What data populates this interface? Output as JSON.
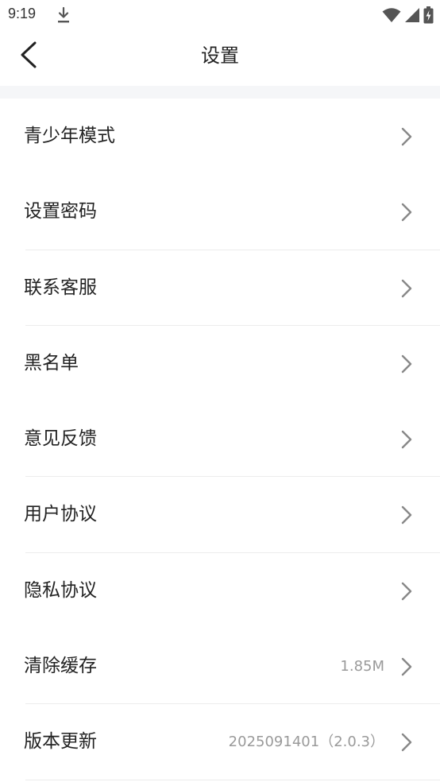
{
  "status_bar": {
    "time": "9:19"
  },
  "header": {
    "title": "设置"
  },
  "settings": {
    "items": [
      {
        "label": "青少年模式",
        "value": "",
        "divider": false
      },
      {
        "label": "设置密码",
        "value": "",
        "divider": true
      },
      {
        "label": "联系客服",
        "value": "",
        "divider": true
      },
      {
        "label": "黑名单",
        "value": "",
        "divider": false
      },
      {
        "label": "意见反馈",
        "value": "",
        "divider": true
      },
      {
        "label": "用户协议",
        "value": "",
        "divider": true
      },
      {
        "label": "隐私协议",
        "value": "",
        "divider": false
      },
      {
        "label": "清除缓存",
        "value": "1.85M",
        "divider": true
      },
      {
        "label": "版本更新",
        "value": "2025091401（2.0.3）",
        "divider": true
      }
    ]
  }
}
